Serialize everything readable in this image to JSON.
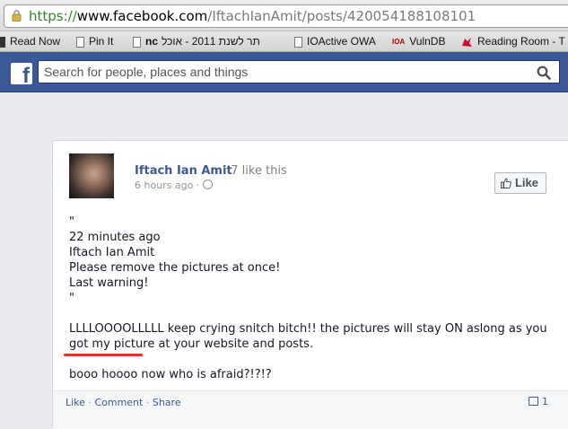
{
  "browser": {
    "url_scheme": "https://",
    "url_host": "www.facebook.com",
    "url_path": "/IftachIanAmit/posts/420054188108101",
    "bookmarks": [
      {
        "label": "Read Now",
        "icon": "bookmark-icon"
      },
      {
        "label": "Pin It",
        "icon": "page-icon"
      },
      {
        "label": "תר לשנת 2011 - אוכל",
        "icon": "page-icon"
      },
      {
        "label": "IOActive OWA",
        "icon": "page-icon"
      },
      {
        "label": "VulnDB",
        "icon": "ioa-icon"
      },
      {
        "label": "Reading Room - T",
        "icon": "dragon-icon"
      }
    ]
  },
  "topbar": {
    "logo": "f",
    "search_placeholder": "Search for people, places and things"
  },
  "post": {
    "author": "Iftach Ian Amit",
    "like_count": "· 7 like this",
    "timestamp": "6 hours ago ·",
    "like_button": "Like",
    "lines": [
      "\"",
      "22 minutes ago",
      "Iftach Ian Amit",
      "Please remove the pictures at once!",
      "Last warning!",
      "\"",
      "",
      "LLLLOOOOLLLLL keep crying snitch bitch!! the pictures will stay ON aslong as you",
      "got my picture at your website and posts.",
      "",
      "booo hoooo now who is afraid?!?!?"
    ],
    "actions": {
      "like": "Like",
      "comment": "Comment",
      "share": "Share",
      "sep": "·",
      "comment_count": "1"
    }
  },
  "colors": {
    "facebook_blue": "#3b5998",
    "highlight_underline": "#e0352b"
  }
}
